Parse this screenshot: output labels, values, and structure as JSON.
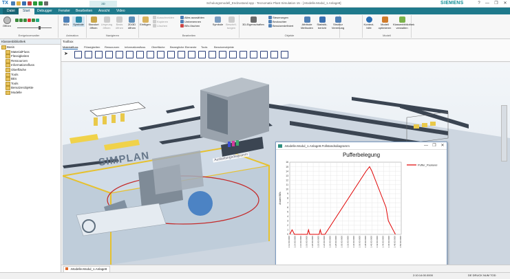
{
  "app": {
    "logo": "TX",
    "title": "Schulungsmodell_Endzustand.spp - Tecnomatix Plant Simulation 15 - [.Modelle.Modul_1.Anlage8]",
    "brand": "SIEMENS",
    "context_tab": "3D"
  },
  "window_controls": {
    "help": "?",
    "minimize": "—",
    "restore": "❐",
    "close": "✕"
  },
  "ribbon_tabs": [
    "Datei",
    "Start",
    "Debugger",
    "Fenster",
    "Bearbeiten",
    "Ansicht",
    "Video"
  ],
  "search_placeholder": "Einen Befehl suchen",
  "ribbon": {
    "groups": {
      "ereignisverwalter": "Ereignisverwalter",
      "animation": "Animation",
      "navigieren": "Navigieren",
      "bearbeiten": "Bearbeiten",
      "objekte": "Objekte",
      "modell": "Modell"
    },
    "buttons": {
      "oeffnen": "Öffnen",
      "ibes": "IBEs",
      "symbole": "Symbole",
      "standort_oeffnen": "Standort öffnen",
      "ursprung_oeffnen": "Ursprung öffnen",
      "basis_oeffnen": "Basis öffnen",
      "view_2d3d": "2D/3D öffnen",
      "einfuegen": "Einfügen",
      "ausschneiden": "Ausschneiden",
      "kopieren": "Kopieren",
      "loeschen": "Löschen",
      "alles_auswaehlen": "Alles auswählen",
      "umbenennen": "Umbenennen",
      "bes_loeschen": "BEs löschen",
      "symbole2": "Symbole",
      "beschriftungen": "Beschrif-tungen",
      "eigenschaften_3d": "3D-Eigenschaften",
      "steuerungen": "Steuerungen",
      "beobachter": "Beobachter",
      "benutzerdefiniert": "Benutzerdefiniert",
      "attribute_methoden": "Attribute Methoden",
      "statistikbericht": "Statistik-bericht",
      "struktur_vererbung": "Struktur Vererbung",
      "kontexthilfe": "Kontext-hilfe",
      "modell_optimieren": "Modell optimieren",
      "klassenbibliothek_verwalten": "Klassenbibliothek verwalten"
    }
  },
  "class_library": {
    "title": "Klassenbibliothek",
    "items": [
      {
        "label": "Basis",
        "level": 0
      },
      {
        "label": "MaterialFluss",
        "level": 1
      },
      {
        "label": "Flüssigkeiten",
        "level": 1
      },
      {
        "label": "Ressourcen",
        "level": 1
      },
      {
        "label": "Informationsfluss",
        "level": 1
      },
      {
        "label": "Oberfläche",
        "level": 1
      },
      {
        "label": "Tools",
        "level": 1
      },
      {
        "label": "BEs",
        "level": 1
      },
      {
        "label": "Tools",
        "level": 1
      },
      {
        "label": "Benutzerobjekte",
        "level": 1
      },
      {
        "label": "Modelle",
        "level": 1
      }
    ]
  },
  "toolbox": {
    "title": "Toolbox",
    "tabs": [
      "Materialfluss",
      "Flüssigkeiten",
      "Ressourcen",
      "Informationsfluss",
      "Oberfläche",
      "Bewegliche Elemente",
      "Tools",
      "Benutzerobjekte"
    ],
    "active_tab": "Materialfluss",
    "tool_count": 22
  },
  "view3d": {
    "floor_logo": "SIMPLAN",
    "area_label": "Auslastungsdiagramm"
  },
  "chart_window": {
    "title": ".Modelle.Modul_1.Anlage8.Füllstandsdiagramm"
  },
  "chart_data": {
    "type": "line",
    "title": "Pufferbelegung",
    "xlabel": "Zeit",
    "ylabel": "Anzahl BEs",
    "yticks": [
      0,
      1,
      2,
      3,
      4,
      5,
      6,
      7,
      8,
      9,
      10,
      11,
      12,
      13,
      14,
      15,
      16
    ],
    "ylim": [
      0,
      16
    ],
    "xticks": [
      "1:12:00.0000",
      "1:14:00.0000",
      "1:16:00.0000",
      "1:18:00.0000",
      "1:20:00.0000",
      "1:22:00.0000",
      "1:24:00.0000",
      "1:26:00.0000",
      "1:28:00.0000",
      "1:30:00.0000",
      "1:32:00.0000",
      "1:34:00.0000",
      "1:36:00.0000",
      "1:38:00.0000",
      "1:40:00.0000",
      "1:42:00.0000",
      "1:44:00.0000",
      "1:46:00.0000",
      "1:48:00.0000",
      "1:50:00.0000"
    ],
    "grid": true,
    "legend": "right",
    "series": [
      {
        "name": "Puffer_Packerei",
        "color": "#e00000",
        "points": [
          [
            0,
            0
          ],
          [
            0.4,
            1
          ],
          [
            0.8,
            0
          ],
          [
            3,
            0
          ],
          [
            3.2,
            1
          ],
          [
            3.4,
            0
          ],
          [
            5,
            0
          ],
          [
            5.2,
            1
          ],
          [
            5.4,
            0
          ],
          [
            6,
            0
          ],
          [
            7,
            2
          ],
          [
            8,
            4
          ],
          [
            9,
            6
          ],
          [
            10,
            8
          ],
          [
            11,
            10
          ],
          [
            12,
            12
          ],
          [
            13,
            14
          ],
          [
            13.6,
            15
          ],
          [
            14,
            14
          ],
          [
            14.6,
            12
          ],
          [
            15.2,
            10
          ],
          [
            15.8,
            8
          ],
          [
            16.4,
            6
          ],
          [
            16.8,
            3
          ],
          [
            17.2,
            2
          ],
          [
            17.6,
            1
          ],
          [
            18,
            0
          ]
        ]
      }
    ]
  },
  "doc_tab": ".Modelle.Modul_1.Anlage8",
  "status": {
    "time": "2:10:14:00.0000",
    "right": "DE  DRUCK  NUM  TOD"
  }
}
